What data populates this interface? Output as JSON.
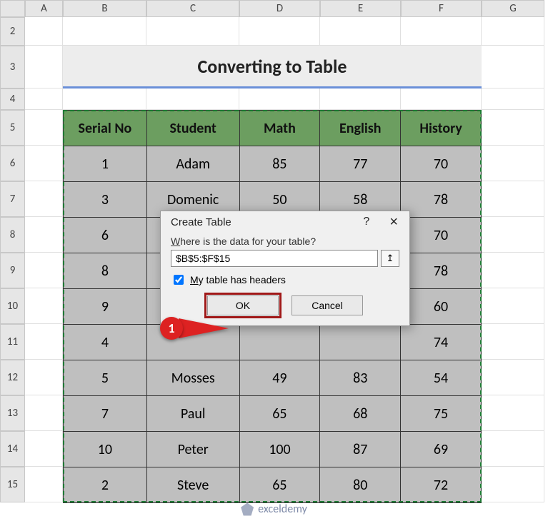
{
  "columns": [
    "A",
    "B",
    "C",
    "D",
    "E",
    "F",
    "G"
  ],
  "rows": [
    "2",
    "3",
    "4",
    "5",
    "6",
    "7",
    "8",
    "9",
    "10",
    "11",
    "12",
    "13",
    "14",
    "15"
  ],
  "title": "Converting to Table",
  "headers": {
    "b": "Serial No",
    "c": "Student",
    "d": "Math",
    "e": "English",
    "f": "History"
  },
  "chart_data": {
    "type": "table",
    "columns": [
      "Serial No",
      "Student",
      "Math",
      "English",
      "History"
    ],
    "rows": [
      [
        1,
        "Adam",
        85,
        77,
        70
      ],
      [
        3,
        "Domenic",
        50,
        58,
        78
      ],
      [
        6,
        "",
        "",
        "",
        70
      ],
      [
        8,
        "",
        "",
        "",
        78
      ],
      [
        9,
        "",
        "",
        "",
        60
      ],
      [
        4,
        "",
        "",
        "",
        74
      ],
      [
        5,
        "Mosses",
        49,
        83,
        54
      ],
      [
        7,
        "Paul",
        65,
        68,
        75
      ],
      [
        10,
        "Peter",
        100,
        87,
        69
      ],
      [
        2,
        "Steve",
        65,
        80,
        72
      ]
    ]
  },
  "dialog": {
    "title": "Create Table",
    "question_mark": "?",
    "close": "×",
    "label_prefix": "W",
    "label_rest": "here is the data for your table?",
    "range": "$B$5:$F$15",
    "ref_icon": "↥",
    "checkbox_checked": true,
    "checkbox_label_prefix": "M",
    "checkbox_label_rest": "y table has headers",
    "ok": "OK",
    "cancel": "Cancel"
  },
  "callout_number": "1",
  "watermark": "exceldemy"
}
